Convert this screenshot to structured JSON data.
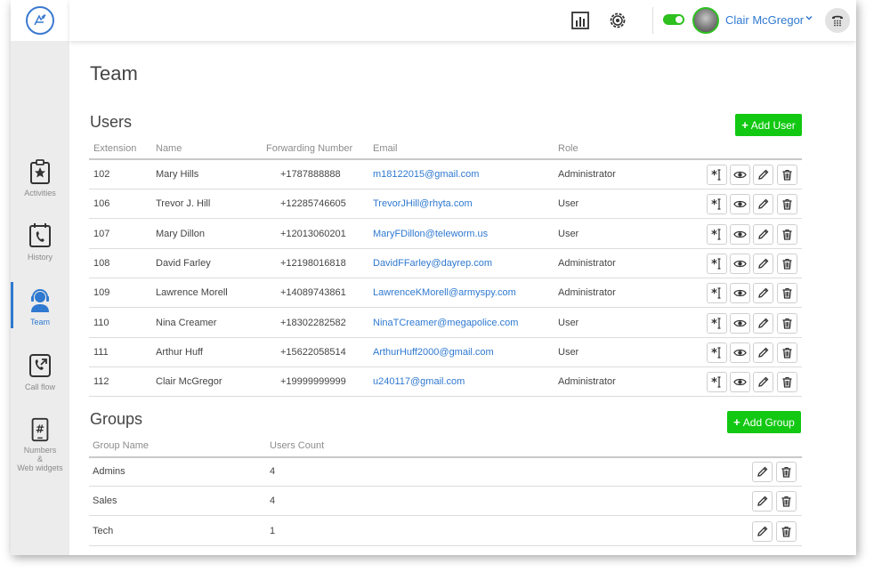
{
  "sidebar": {
    "items": [
      {
        "label": "Activities",
        "icon": "star-clipboard-icon"
      },
      {
        "label": "History",
        "icon": "phone-calendar-icon"
      },
      {
        "label": "Team",
        "icon": "headset-user-icon"
      },
      {
        "label": "Call flow",
        "icon": "call-flow-icon"
      },
      {
        "label": "Numbers & Web widgets",
        "label_lines": [
          "Numbers",
          "&",
          "Web widgets"
        ],
        "icon": "hash-phone-icon"
      }
    ],
    "active": "Team"
  },
  "header": {
    "user_name": "Clair McGregor",
    "status_toggle_on": true,
    "icons": [
      "logo-icon",
      "bar-chart-icon",
      "settings-gear-icon",
      "chevron-down-icon",
      "dialpad-icon"
    ]
  },
  "page": {
    "title": "Team"
  },
  "users": {
    "title": "Users",
    "add_button": "Add User",
    "columns": [
      "Extension",
      "Name",
      "Forwarding Number",
      "Email",
      "Role"
    ],
    "rows": [
      {
        "extension": "102",
        "name": "Mary Hills",
        "forwarding": "+1787888888",
        "email": "m18122015@gmail.com",
        "role": "Administrator"
      },
      {
        "extension": "106",
        "name": "Trevor J. Hill",
        "forwarding": "+12285746605",
        "email": "TrevorJHill@rhyta.com",
        "role": "User"
      },
      {
        "extension": "107",
        "name": "Mary Dillon",
        "forwarding": "+12013060201",
        "email": "MaryFDillon@teleworm.us",
        "role": "User"
      },
      {
        "extension": "108",
        "name": "David Farley",
        "forwarding": "+12198016818",
        "email": "DavidFFarley@dayrep.com",
        "role": "Administrator"
      },
      {
        "extension": "109",
        "name": "Lawrence Morell",
        "forwarding": "+14089743861",
        "email": "LawrenceKMorell@armyspy.com",
        "role": "Administrator"
      },
      {
        "extension": "110",
        "name": "Nina Creamer",
        "forwarding": "+18302282582",
        "email": "NinaTCreamer@megapolice.com",
        "role": "User"
      },
      {
        "extension": "111",
        "name": "Arthur Huff",
        "forwarding": "+15622058514",
        "email": "ArthurHuff2000@gmail.com",
        "role": "User"
      },
      {
        "extension": "112",
        "name": "Clair McGregor",
        "forwarding": "+19999999999",
        "email": "u240117@gmail.com",
        "role": "Administrator"
      }
    ],
    "row_actions": [
      "asterisk-cursor-icon",
      "eye-icon",
      "pencil-icon",
      "trash-icon"
    ]
  },
  "groups": {
    "title": "Groups",
    "add_button": "Add Group",
    "columns": [
      "Group Name",
      "Users Count"
    ],
    "rows": [
      {
        "name": "Admins",
        "count": "4"
      },
      {
        "name": "Sales",
        "count": "4"
      },
      {
        "name": "Tech",
        "count": "1"
      }
    ],
    "row_actions": [
      "pencil-icon",
      "trash-icon"
    ]
  },
  "colors": {
    "accent_blue": "#2f79d0",
    "green_button": "#12c812",
    "toggle_green": "#2dc01f",
    "sidebar_bg": "#ececec"
  }
}
